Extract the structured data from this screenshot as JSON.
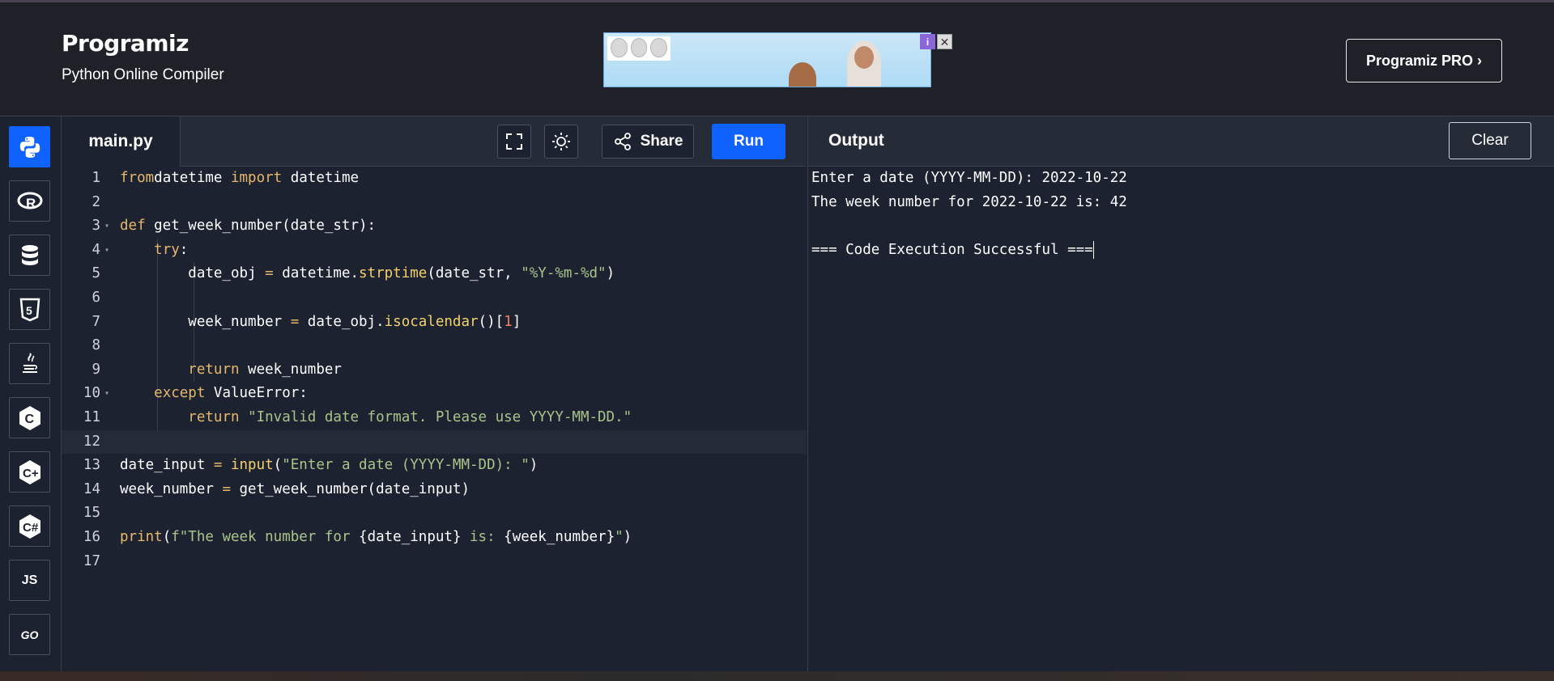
{
  "header": {
    "logo_text": "Programiz",
    "subtitle": "Python Online Compiler",
    "ad_badge": "i",
    "ad_close": "✕",
    "pro_button": "Programiz PRO ›"
  },
  "sidebar": {
    "items": [
      {
        "name": "python",
        "label": "",
        "icon": "python-icon"
      },
      {
        "name": "r",
        "label": "R",
        "icon": "r-icon"
      },
      {
        "name": "sql",
        "label": "",
        "icon": "database-icon"
      },
      {
        "name": "html",
        "label": "5",
        "icon": "html5-icon"
      },
      {
        "name": "java",
        "label": "",
        "icon": "java-icon"
      },
      {
        "name": "c",
        "label": "C",
        "icon": "c-icon"
      },
      {
        "name": "cpp",
        "label": "C+",
        "icon": "cpp-icon"
      },
      {
        "name": "csharp",
        "label": "C#",
        "icon": "csharp-icon"
      },
      {
        "name": "js",
        "label": "JS",
        "icon": "js-icon"
      },
      {
        "name": "go",
        "label": "GO",
        "icon": "go-icon"
      }
    ]
  },
  "editor": {
    "file_tab": "main.py",
    "share_label": "Share",
    "run_label": "Run",
    "current_line": 12,
    "lines": [
      {
        "n": "1",
        "tokens": [
          [
            "kw",
            "from"
          ],
          [
            "",
            "datetime "
          ],
          [
            "kw",
            "import"
          ],
          [
            "",
            " datetime"
          ]
        ]
      },
      {
        "n": "2",
        "tokens": []
      },
      {
        "n": "3",
        "fold": true,
        "tokens": [
          [
            "kw",
            "def"
          ],
          [
            "",
            " get_week_number(date_str):"
          ]
        ]
      },
      {
        "n": "4",
        "fold": true,
        "tokens": [
          [
            "",
            "    "
          ],
          [
            "kw",
            "try"
          ],
          [
            "",
            ":"
          ]
        ]
      },
      {
        "n": "5",
        "tokens": [
          [
            "",
            "        date_obj "
          ],
          [
            "op",
            "="
          ],
          [
            "",
            " datetime."
          ],
          [
            "fn",
            "strptime"
          ],
          [
            "",
            "(date_str, "
          ],
          [
            "str",
            "\"%Y-%m-%d\""
          ],
          [
            "",
            ")"
          ]
        ]
      },
      {
        "n": "6",
        "tokens": []
      },
      {
        "n": "7",
        "tokens": [
          [
            "",
            "        week_number "
          ],
          [
            "op",
            "="
          ],
          [
            "",
            " date_obj."
          ],
          [
            "fn",
            "isocalendar"
          ],
          [
            "",
            "()["
          ],
          [
            "num",
            "1"
          ],
          [
            "",
            "]"
          ]
        ]
      },
      {
        "n": "8",
        "tokens": []
      },
      {
        "n": "9",
        "tokens": [
          [
            "",
            "        "
          ],
          [
            "kw",
            "return"
          ],
          [
            "",
            " week_number"
          ]
        ]
      },
      {
        "n": "10",
        "fold": true,
        "tokens": [
          [
            "",
            "    "
          ],
          [
            "kw",
            "except"
          ],
          [
            "",
            " ValueError:"
          ]
        ]
      },
      {
        "n": "11",
        "tokens": [
          [
            "",
            "        "
          ],
          [
            "kw",
            "return"
          ],
          [
            "str",
            " \"Invalid date format. Please use YYYY-MM-DD.\""
          ]
        ]
      },
      {
        "n": "12",
        "tokens": []
      },
      {
        "n": "13",
        "tokens": [
          [
            "",
            "date_input "
          ],
          [
            "op",
            "="
          ],
          [
            "fn",
            " input"
          ],
          [
            "",
            "("
          ],
          [
            "str",
            "\"Enter a date (YYYY-MM-DD): \""
          ],
          [
            "",
            ")"
          ]
        ]
      },
      {
        "n": "14",
        "tokens": [
          [
            "",
            "week_number "
          ],
          [
            "op",
            "="
          ],
          [
            "",
            " get_week_number(date_input)"
          ]
        ]
      },
      {
        "n": "15",
        "tokens": []
      },
      {
        "n": "16",
        "tokens": [
          [
            "kw",
            "print"
          ],
          [
            "",
            "("
          ],
          [
            "str",
            "f\"The week number for "
          ],
          [
            "",
            "{date_input}"
          ],
          [
            "str",
            " is: "
          ],
          [
            "",
            "{week_number}"
          ],
          [
            "str",
            "\""
          ],
          [
            "",
            ")"
          ]
        ]
      },
      {
        "n": "17",
        "tokens": []
      }
    ]
  },
  "output": {
    "title": "Output",
    "clear_label": "Clear",
    "lines": [
      "Enter a date (YYYY-MM-DD): 2022-10-22",
      "The week number for 2022-10-22 is: 42",
      "",
      "=== Code Execution Successful ==="
    ]
  },
  "colors": {
    "accent": "#0f62fe",
    "keyword": "#e5b86c",
    "string": "#a8c48a",
    "function": "#f2d16b",
    "number": "#f08060",
    "background": "#1d2230"
  }
}
